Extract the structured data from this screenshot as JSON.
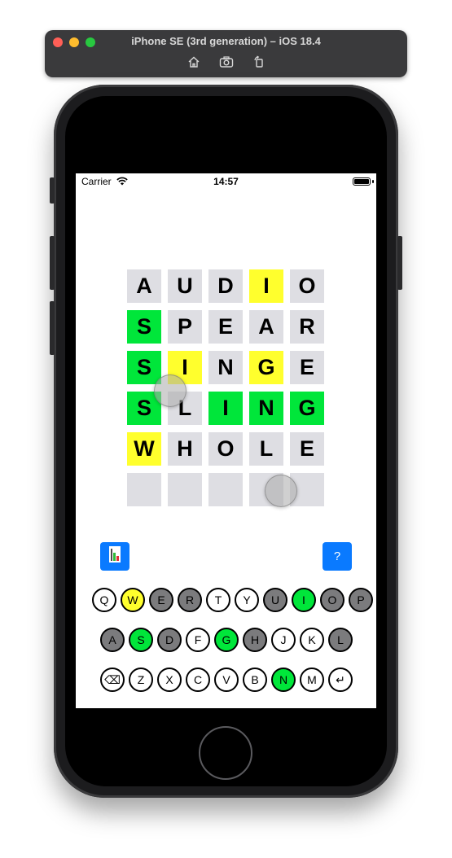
{
  "simulator": {
    "title": "iPhone SE (3rd generation) – iOS 18.4",
    "tools": [
      "home-icon",
      "screenshot-icon",
      "rotate-icon"
    ]
  },
  "status_bar": {
    "carrier": "Carrier",
    "time": "14:57"
  },
  "grid": [
    [
      {
        "l": "A",
        "s": "empty"
      },
      {
        "l": "U",
        "s": "empty"
      },
      {
        "l": "D",
        "s": "empty"
      },
      {
        "l": "I",
        "s": "yellow"
      },
      {
        "l": "O",
        "s": "empty"
      }
    ],
    [
      {
        "l": "S",
        "s": "green"
      },
      {
        "l": "P",
        "s": "empty"
      },
      {
        "l": "E",
        "s": "empty"
      },
      {
        "l": "A",
        "s": "empty"
      },
      {
        "l": "R",
        "s": "empty"
      }
    ],
    [
      {
        "l": "S",
        "s": "green"
      },
      {
        "l": "I",
        "s": "yellow"
      },
      {
        "l": "N",
        "s": "empty"
      },
      {
        "l": "G",
        "s": "yellow"
      },
      {
        "l": "E",
        "s": "empty"
      }
    ],
    [
      {
        "l": "S",
        "s": "green"
      },
      {
        "l": "L",
        "s": "empty"
      },
      {
        "l": "I",
        "s": "green"
      },
      {
        "l": "N",
        "s": "green"
      },
      {
        "l": "G",
        "s": "green"
      }
    ],
    [
      {
        "l": "W",
        "s": "yellow"
      },
      {
        "l": "H",
        "s": "empty"
      },
      {
        "l": "O",
        "s": "empty"
      },
      {
        "l": "L",
        "s": "empty"
      },
      {
        "l": "E",
        "s": "empty"
      }
    ],
    [
      {
        "l": "",
        "s": "empty"
      },
      {
        "l": "",
        "s": "empty"
      },
      {
        "l": "",
        "s": "empty"
      },
      {
        "l": "",
        "s": "empty"
      },
      {
        "l": "",
        "s": "empty"
      }
    ]
  ],
  "buttons": {
    "stats_icon": "bar-chart-icon",
    "help_label": "?"
  },
  "keyboard": {
    "rows": [
      [
        {
          "k": "Q",
          "s": "none"
        },
        {
          "k": "W",
          "s": "yellow"
        },
        {
          "k": "E",
          "s": "gray"
        },
        {
          "k": "R",
          "s": "gray"
        },
        {
          "k": "T",
          "s": "none"
        },
        {
          "k": "Y",
          "s": "none"
        },
        {
          "k": "U",
          "s": "gray"
        },
        {
          "k": "I",
          "s": "green"
        },
        {
          "k": "O",
          "s": "gray"
        },
        {
          "k": "P",
          "s": "gray"
        }
      ],
      [
        {
          "k": "A",
          "s": "gray"
        },
        {
          "k": "S",
          "s": "green"
        },
        {
          "k": "D",
          "s": "gray"
        },
        {
          "k": "F",
          "s": "none"
        },
        {
          "k": "G",
          "s": "green"
        },
        {
          "k": "H",
          "s": "gray"
        },
        {
          "k": "J",
          "s": "none"
        },
        {
          "k": "K",
          "s": "none"
        },
        {
          "k": "L",
          "s": "gray"
        }
      ],
      [
        {
          "k": "⌫",
          "s": "none",
          "name": "backspace-key"
        },
        {
          "k": "Z",
          "s": "none"
        },
        {
          "k": "X",
          "s": "none"
        },
        {
          "k": "C",
          "s": "none"
        },
        {
          "k": "V",
          "s": "none"
        },
        {
          "k": "B",
          "s": "none"
        },
        {
          "k": "N",
          "s": "green"
        },
        {
          "k": "M",
          "s": "none"
        },
        {
          "k": "↵",
          "s": "none",
          "name": "enter-key"
        }
      ]
    ]
  },
  "colors": {
    "green": "#00e63a",
    "yellow": "#ffff2d",
    "gray": "#7b7b7d",
    "empty": "#dedee3",
    "accent": "#0a7aff"
  }
}
